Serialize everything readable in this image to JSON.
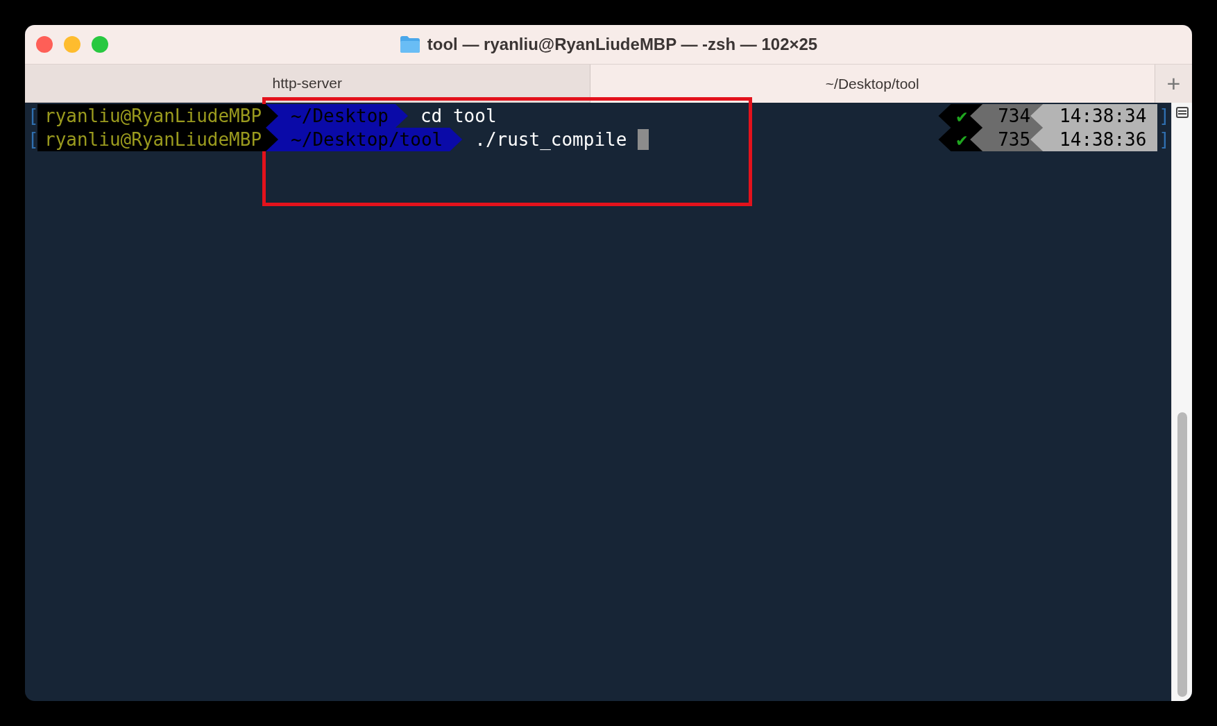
{
  "window": {
    "title": "tool — ryanliu@RyanLiudeMBP — -zsh — 102×25"
  },
  "tabs": [
    {
      "label": "http-server",
      "selected": false
    },
    {
      "label": "~/Desktop/tool",
      "selected": true
    }
  ],
  "new_tab_button": "+",
  "lines": [
    {
      "open_bracket": "[",
      "user": "ryanliu@RyanLiudeMBP",
      "path": "~/Desktop",
      "command": "cd tool",
      "cursor": false,
      "status": "✔",
      "history": "734",
      "time": "14:38:34",
      "close_bracket": "]"
    },
    {
      "open_bracket": "[",
      "user": "ryanliu@RyanLiudeMBP",
      "path": "~/Desktop/tool",
      "command": "./rust_compile",
      "cursor": true,
      "status": "✔",
      "history": "735",
      "time": "14:38:36",
      "close_bracket": "]"
    }
  ]
}
